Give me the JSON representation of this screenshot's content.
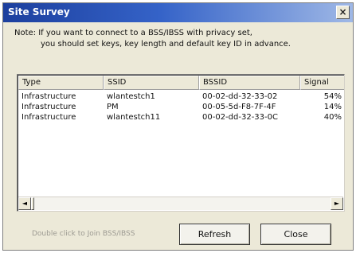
{
  "window": {
    "title": "Site Survey",
    "close_glyph": "×"
  },
  "note": {
    "line1": "Note: If you want to connect to a BSS/IBSS with privacy set,",
    "line2": "you should set keys, key length and default key ID in advance."
  },
  "table": {
    "columns": [
      "Type",
      "SSID",
      "BSSID",
      "Signal"
    ],
    "rows": [
      {
        "type": "Infrastructure",
        "ssid": "wlantestch1",
        "bssid": "00-02-dd-32-33-02",
        "signal": "54%"
      },
      {
        "type": "Infrastructure",
        "ssid": "PM",
        "bssid": "00-05-5d-F8-7F-4F",
        "signal": "14%"
      },
      {
        "type": "Infrastructure",
        "ssid": "wlantestch11",
        "bssid": "00-02-dd-32-33-0C",
        "signal": "40%"
      }
    ]
  },
  "scrollbar": {
    "left_glyph": "◄",
    "right_glyph": "►"
  },
  "footer": {
    "hint": "Double click to Join BSS/IBSS",
    "refresh_label": "Refresh",
    "close_label": "Close"
  },
  "colors": {
    "title_start": "#1c3f9e",
    "title_end": "#9fb8e6",
    "dialog_bg": "#ece9d8"
  },
  "icons": {
    "close": "close-icon",
    "scroll_left": "arrow-left-icon",
    "scroll_right": "arrow-right-icon"
  }
}
